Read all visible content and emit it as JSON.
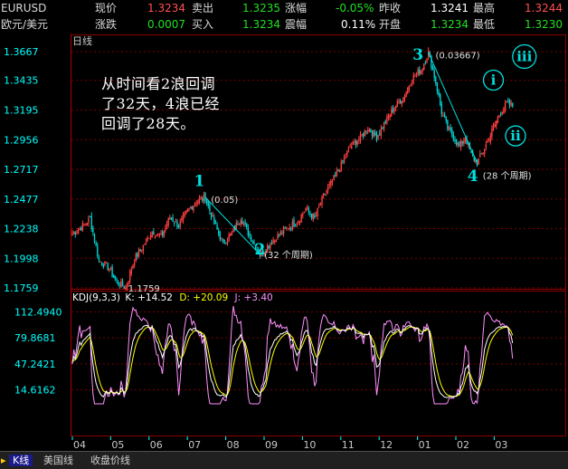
{
  "quote": {
    "symbol": "EURUSD",
    "name": "欧元/美元",
    "price_label": "现价",
    "price": "1.3234",
    "sell_label": "卖出",
    "sell": "1.3235",
    "change_pct_label": "涨幅",
    "change_pct": "-0.05%",
    "prev_close_label": "昨收",
    "prev_close": "1.3241",
    "high_label": "最高",
    "high": "1.3244",
    "change_label": "涨跌",
    "change": "0.0007",
    "buy_label": "买入",
    "buy": "1.3234",
    "amplitude_label": "震幅",
    "amplitude": "0.11%",
    "open_label": "开盘",
    "open": "1.3234",
    "low_label": "最低",
    "low": "1.3230"
  },
  "period_label": "日线",
  "annotation_lines": [
    "从时间看2浪回调",
    "了32天，4浪已经",
    "回调了28天。"
  ],
  "bottom_tabs": [
    "K线",
    "美国线",
    "收盘价线"
  ],
  "colors": {
    "up": "#ff4040",
    "down": "#00d0d0",
    "k": "#ffffff",
    "d": "#ffff00",
    "j": "#ff90ff",
    "grid": "#7a0000",
    "axis": "#00ffff",
    "accent": "#00e0e0"
  },
  "chart_data": [
    {
      "type": "candlestick",
      "title": "日线",
      "ylim": [
        1.1759,
        1.3667
      ],
      "y_ticks": [
        "1.3667",
        "1.3435",
        "1.3195",
        "1.2956",
        "1.2717",
        "1.2477",
        "1.2238",
        "1.1998",
        "1.1759"
      ],
      "x_ticks": [
        "04",
        "05",
        "06",
        "07",
        "08",
        "09",
        "10",
        "11",
        "12",
        "01",
        "02",
        "03"
      ],
      "price_path": [
        [
          0,
          1.22
        ],
        [
          6,
          1.225
        ],
        [
          12,
          1.232
        ],
        [
          18,
          1.198
        ],
        [
          24,
          1.193
        ],
        [
          30,
          1.181
        ],
        [
          36,
          1.176
        ],
        [
          42,
          1.199
        ],
        [
          48,
          1.21
        ],
        [
          54,
          1.222
        ],
        [
          60,
          1.217
        ],
        [
          66,
          1.233
        ],
        [
          72,
          1.226
        ],
        [
          78,
          1.238
        ],
        [
          84,
          1.246
        ],
        [
          90,
          1.249
        ],
        [
          96,
          1.228
        ],
        [
          102,
          1.212
        ],
        [
          108,
          1.22
        ],
        [
          114,
          1.233
        ],
        [
          120,
          1.218
        ],
        [
          127,
          1.203
        ],
        [
          134,
          1.212
        ],
        [
          140,
          1.219
        ],
        [
          146,
          1.225
        ],
        [
          152,
          1.229
        ],
        [
          158,
          1.24
        ],
        [
          164,
          1.232
        ],
        [
          170,
          1.25
        ],
        [
          176,
          1.262
        ],
        [
          182,
          1.275
        ],
        [
          188,
          1.29
        ],
        [
          194,
          1.296
        ],
        [
          200,
          1.305
        ],
        [
          206,
          1.298
        ],
        [
          212,
          1.31
        ],
        [
          218,
          1.322
        ],
        [
          224,
          1.33
        ],
        [
          230,
          1.345
        ],
        [
          236,
          1.352
        ],
        [
          241,
          1.366
        ],
        [
          246,
          1.342
        ],
        [
          250,
          1.318
        ],
        [
          254,
          1.305
        ],
        [
          258,
          1.298
        ],
        [
          262,
          1.29
        ],
        [
          266,
          1.298
        ],
        [
          270,
          1.283
        ],
        [
          274,
          1.277
        ],
        [
          278,
          1.286
        ],
        [
          282,
          1.297
        ],
        [
          286,
          1.308
        ],
        [
          290,
          1.318
        ],
        [
          294,
          1.325
        ],
        [
          298,
          1.323
        ]
      ],
      "annotations": [
        {
          "text": "1.1759",
          "x": 36,
          "y": 1.1759
        },
        {
          "text": "(0.05)",
          "x": 92,
          "y": 1.2477
        },
        {
          "text": "(32 个周期)",
          "x": 128,
          "y": 1.203
        },
        {
          "text": "(0.03667)",
          "x": 244,
          "y": 1.364
        },
        {
          "text": "(28 个周期)",
          "x": 276,
          "y": 1.267
        }
      ],
      "wave_labels": [
        {
          "text": "1",
          "x": 86,
          "y": 1.258
        },
        {
          "text": "2",
          "x": 127,
          "y": 1.203
        },
        {
          "text": "3",
          "x": 234,
          "y": 1.36
        },
        {
          "text": "4",
          "x": 271,
          "y": 1.262
        },
        {
          "text": "i",
          "x": 285,
          "y": 1.34
        },
        {
          "text": "ii",
          "x": 300,
          "y": 1.295
        },
        {
          "text": "iii",
          "x": 306,
          "y": 1.359
        }
      ],
      "trend_lines": [
        {
          "from": [
            90,
            1.249
          ],
          "to": [
            127,
            1.203
          ]
        },
        {
          "from": [
            241,
            1.366
          ],
          "to": [
            274,
            1.277
          ]
        }
      ]
    },
    {
      "type": "line",
      "title": "KDJ(9,3,3)",
      "ylim": [
        -3.0,
        121.0
      ],
      "y_ticks": [
        "112.4940",
        "79.8681",
        "47.2421",
        "14.6162"
      ],
      "series": [
        {
          "name": "K",
          "last_value": "+14.52"
        },
        {
          "name": "D",
          "last_value": "+20.09"
        },
        {
          "name": "J",
          "last_value": "+3.40"
        }
      ]
    }
  ]
}
